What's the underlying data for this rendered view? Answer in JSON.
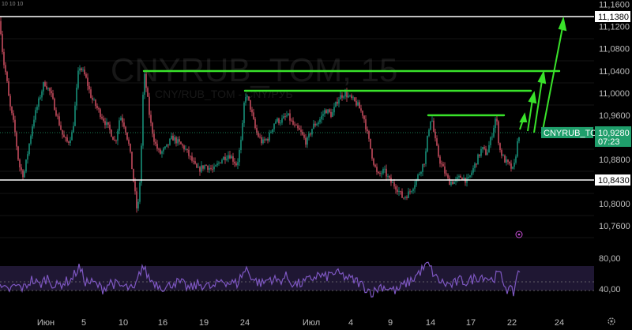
{
  "header": {
    "top_left_text": "10 10 10"
  },
  "watermark": {
    "title": "CNYRUB_TOM, 15",
    "subtitle": "CNY/RUB_TOM - CNY/РУБ"
  },
  "price_axis": {
    "ticks": [
      "11,1600",
      "11,1200",
      "11,0800",
      "11,0400",
      "11,0000",
      "10,9600",
      "10,9200",
      "10,8800",
      "10,8400",
      "10,8000",
      "10,7600"
    ],
    "ylim": [
      10.74,
      11.17
    ]
  },
  "rsi_axis": {
    "ticks": [
      "80,00",
      "40,00"
    ],
    "ylim": [
      10,
      100
    ]
  },
  "time_axis": {
    "ticks": [
      "Июн",
      "5",
      "10",
      "16",
      "19",
      "24",
      "Июл",
      "4",
      "9",
      "14",
      "17",
      "22",
      "24"
    ]
  },
  "annotations": {
    "resistance_label": "11,1380",
    "support_label": "10,8430",
    "current_symbol": "CNYRUB_TOM",
    "current_price": "10,9280",
    "countdown": "07:23"
  },
  "colors": {
    "background": "#000000",
    "candle_up": "#1aa38a",
    "candle_down": "#e0556a",
    "level_line": "#39e22a",
    "rsi_line": "#7e57c2",
    "rsi_band": "#3a2a5c",
    "tag_green": "#1f9e6b",
    "grid": "#1a1a1a"
  },
  "chart_data": [
    {
      "type": "candlestick",
      "title": "CNYRUB_TOM, 15",
      "ylim": [
        10.74,
        11.17
      ],
      "keypoints": [
        [
          0,
          11.13
        ],
        [
          4,
          11.06
        ],
        [
          8,
          11.03
        ],
        [
          12,
          10.98
        ],
        [
          18,
          10.94
        ],
        [
          24,
          10.87
        ],
        [
          30,
          10.85
        ],
        [
          36,
          10.9
        ],
        [
          42,
          10.95
        ],
        [
          48,
          10.98
        ],
        [
          56,
          11.02
        ],
        [
          64,
          11.0
        ],
        [
          72,
          10.96
        ],
        [
          80,
          10.92
        ],
        [
          86,
          10.91
        ],
        [
          92,
          10.93
        ],
        [
          100,
          11.05
        ],
        [
          108,
          11.03
        ],
        [
          116,
          10.99
        ],
        [
          124,
          10.97
        ],
        [
          132,
          10.95
        ],
        [
          140,
          10.93
        ],
        [
          146,
          10.91
        ],
        [
          152,
          10.96
        ],
        [
          158,
          10.94
        ],
        [
          164,
          10.9
        ],
        [
          170,
          10.83
        ],
        [
          174,
          10.78
        ],
        [
          178,
          10.86
        ],
        [
          182,
          11.04
        ],
        [
          186,
          11.0
        ],
        [
          190,
          10.95
        ],
        [
          196,
          10.91
        ],
        [
          202,
          10.89
        ],
        [
          210,
          10.9
        ],
        [
          218,
          10.92
        ],
        [
          226,
          10.91
        ],
        [
          234,
          10.9
        ],
        [
          242,
          10.88
        ],
        [
          250,
          10.86
        ],
        [
          260,
          10.87
        ],
        [
          270,
          10.86
        ],
        [
          280,
          10.88
        ],
        [
          290,
          10.89
        ],
        [
          300,
          10.87
        ],
        [
          306,
          10.92
        ],
        [
          310,
          11.0
        ],
        [
          316,
          10.98
        ],
        [
          324,
          10.93
        ],
        [
          332,
          10.91
        ],
        [
          340,
          10.92
        ],
        [
          348,
          10.95
        ],
        [
          356,
          10.95
        ],
        [
          364,
          10.96
        ],
        [
          372,
          10.94
        ],
        [
          380,
          10.93
        ],
        [
          388,
          10.91
        ],
        [
          396,
          10.94
        ],
        [
          404,
          10.95
        ],
        [
          412,
          10.97
        ],
        [
          420,
          10.96
        ],
        [
          428,
          10.99
        ],
        [
          436,
          11.0
        ],
        [
          444,
          10.99
        ],
        [
          452,
          10.98
        ],
        [
          460,
          10.96
        ],
        [
          466,
          10.92
        ],
        [
          472,
          10.88
        ],
        [
          478,
          10.85
        ],
        [
          486,
          10.86
        ],
        [
          494,
          10.84
        ],
        [
          502,
          10.83
        ],
        [
          510,
          10.81
        ],
        [
          518,
          10.82
        ],
        [
          526,
          10.84
        ],
        [
          532,
          10.86
        ],
        [
          538,
          10.88
        ],
        [
          542,
          10.93
        ],
        [
          546,
          10.96
        ],
        [
          550,
          10.92
        ],
        [
          556,
          10.88
        ],
        [
          562,
          10.86
        ],
        [
          568,
          10.84
        ],
        [
          576,
          10.84
        ],
        [
          584,
          10.85
        ],
        [
          592,
          10.84
        ],
        [
          598,
          10.86
        ],
        [
          604,
          10.88
        ],
        [
          610,
          10.9
        ],
        [
          616,
          10.89
        ],
        [
          622,
          10.92
        ],
        [
          628,
          10.96
        ],
        [
          632,
          10.9
        ],
        [
          638,
          10.88
        ],
        [
          644,
          10.87
        ],
        [
          650,
          10.86
        ],
        [
          656,
          10.92
        ],
        [
          658,
          10.93
        ]
      ]
    },
    {
      "type": "line",
      "title": "RSI",
      "ylim": [
        10,
        100
      ],
      "keypoints": [
        [
          0,
          40
        ],
        [
          10,
          38
        ],
        [
          20,
          44
        ],
        [
          30,
          41
        ],
        [
          40,
          52
        ],
        [
          50,
          45
        ],
        [
          60,
          55
        ],
        [
          70,
          43
        ],
        [
          80,
          48
        ],
        [
          90,
          52
        ],
        [
          100,
          68
        ],
        [
          108,
          50
        ],
        [
          120,
          47
        ],
        [
          130,
          40
        ],
        [
          140,
          49
        ],
        [
          150,
          44
        ],
        [
          160,
          42
        ],
        [
          170,
          38
        ],
        [
          180,
          70
        ],
        [
          190,
          52
        ],
        [
          200,
          46
        ],
        [
          210,
          41
        ],
        [
          220,
          49
        ],
        [
          230,
          47
        ],
        [
          240,
          40
        ],
        [
          250,
          46
        ],
        [
          260,
          45
        ],
        [
          270,
          41
        ],
        [
          280,
          52
        ],
        [
          290,
          48
        ],
        [
          300,
          47
        ],
        [
          306,
          58
        ],
        [
          312,
          66
        ],
        [
          322,
          51
        ],
        [
          332,
          47
        ],
        [
          342,
          54
        ],
        [
          352,
          50
        ],
        [
          362,
          56
        ],
        [
          372,
          46
        ],
        [
          382,
          47
        ],
        [
          392,
          52
        ],
        [
          402,
          58
        ],
        [
          412,
          55
        ],
        [
          422,
          61
        ],
        [
          432,
          58
        ],
        [
          442,
          53
        ],
        [
          452,
          50
        ],
        [
          462,
          42
        ],
        [
          472,
          35
        ],
        [
          482,
          44
        ],
        [
          492,
          41
        ],
        [
          502,
          37
        ],
        [
          512,
          46
        ],
        [
          522,
          52
        ],
        [
          532,
          63
        ],
        [
          542,
          72
        ],
        [
          552,
          54
        ],
        [
          562,
          47
        ],
        [
          572,
          45
        ],
        [
          582,
          51
        ],
        [
          592,
          49
        ],
        [
          602,
          55
        ],
        [
          612,
          57
        ],
        [
          622,
          52
        ],
        [
          632,
          60
        ],
        [
          642,
          40
        ],
        [
          650,
          35
        ],
        [
          656,
          65
        ],
        [
          658,
          66
        ]
      ]
    }
  ]
}
